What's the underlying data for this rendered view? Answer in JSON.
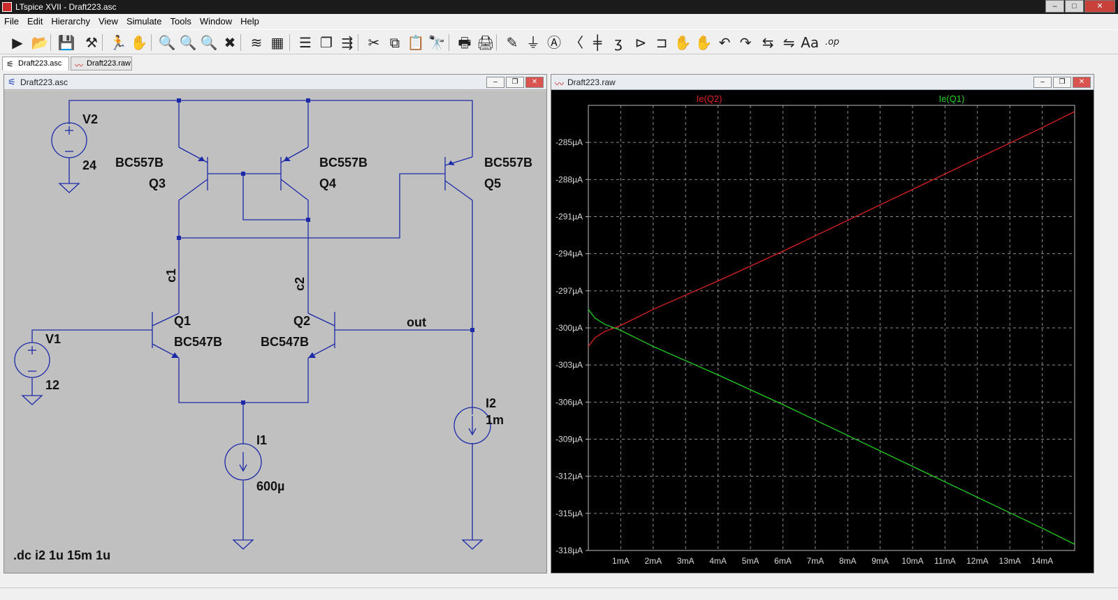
{
  "window": {
    "title": "LTspice XVII - Draft223.asc",
    "min": "–",
    "max": "□",
    "close": "✕"
  },
  "menu": [
    "File",
    "Edit",
    "Hierarchy",
    "View",
    "Simulate",
    "Tools",
    "Window",
    "Help"
  ],
  "toolbar": {
    "icons": [
      "run-icon",
      "open-icon",
      "save-icon",
      "control-panel-icon",
      "halt-icon",
      "hand-icon",
      "zoom-in-icon",
      "zoom-pan-icon",
      "zoom-out-icon",
      "zoom-fit-icon",
      "autorange-icon",
      "grid-icon",
      "tile-horizontal-icon",
      "cascade-icon",
      "tile-vertical-icon",
      "cut-icon",
      "copy-icon",
      "paste-icon",
      "find-icon",
      "print-icon",
      "print-setup-icon",
      "wire-icon",
      "ground-icon",
      "label-icon",
      "resistor-icon",
      "capacitor-icon",
      "inductor-icon",
      "diode-icon",
      "component-icon",
      "move-icon",
      "drag-icon",
      "undo-icon",
      "redo-icon",
      "rotate-icon",
      "mirror-icon",
      "text-icon",
      "spice-directive-icon"
    ],
    "glyphs": [
      "▶",
      "📂",
      "💾",
      "⚒",
      "🏃",
      "✋",
      "🔍",
      "🔍",
      "🔍",
      "✖",
      "≋",
      "▦",
      "☰",
      "❐",
      "⇶",
      "✂",
      "⧉",
      "📋",
      "🔭",
      "🖶",
      "🖨",
      "✎",
      "⏚",
      "Ⓐ",
      "〈",
      "╪",
      "ʒ",
      "⊳",
      "⊐",
      "✋",
      "✋",
      "↶",
      "↷",
      "⇆",
      "⇋",
      "Aa",
      ".op"
    ]
  },
  "tabs": [
    {
      "label": "Draft223.asc",
      "icon": "⚟"
    },
    {
      "label": "Draft223.raw",
      "icon": "〰"
    }
  ],
  "schematic_window": {
    "title": "Draft223.asc",
    "components": {
      "v2": {
        "name": "V2",
        "value": "24"
      },
      "v1": {
        "name": "V1",
        "value": "12"
      },
      "q3": {
        "model": "BC557B",
        "name": "Q3"
      },
      "q4": {
        "model": "BC557B",
        "name": "Q4"
      },
      "q5": {
        "model": "BC557B",
        "name": "Q5"
      },
      "q1": {
        "name": "Q1",
        "model": "BC547B"
      },
      "q2": {
        "name": "Q2",
        "model": "BC547B"
      },
      "i1": {
        "name": "I1",
        "value": "600µ"
      },
      "i2": {
        "name": "I2",
        "value": "1m"
      }
    },
    "net_labels": {
      "c1": "c1",
      "c2": "c2",
      "out": "out"
    },
    "directive": ".dc i2 1u 15m 1u"
  },
  "plot_window": {
    "title": "Draft223.raw"
  },
  "chart_data": {
    "type": "line",
    "xlim": [
      0,
      15
    ],
    "ylim": [
      -318,
      -282
    ],
    "x_ticks": [
      "1mA",
      "2mA",
      "3mA",
      "4mA",
      "5mA",
      "6mA",
      "7mA",
      "8mA",
      "9mA",
      "10mA",
      "11mA",
      "12mA",
      "13mA",
      "14mA"
    ],
    "x_tick_values": [
      1,
      2,
      3,
      4,
      5,
      6,
      7,
      8,
      9,
      10,
      11,
      12,
      13,
      14
    ],
    "y_ticks": [
      "-285µA",
      "-288µA",
      "-291µA",
      "-294µA",
      "-297µA",
      "-300µA",
      "-303µA",
      "-306µA",
      "-309µA",
      "-312µA",
      "-315µA",
      "-318µA"
    ],
    "y_tick_values": [
      -285,
      -288,
      -291,
      -294,
      -297,
      -300,
      -303,
      -306,
      -309,
      -312,
      -315,
      -318
    ],
    "grid": true,
    "series": [
      {
        "name": "Ie(Q2)",
        "color": "#e02020",
        "x": [
          0,
          0.2,
          0.5,
          1,
          2,
          4,
          6,
          8,
          10,
          12,
          14,
          15
        ],
        "y": [
          -301.5,
          -300.8,
          -300.3,
          -299.8,
          -298.5,
          -296.2,
          -293.8,
          -291.3,
          -288.8,
          -286.3,
          -283.8,
          -282.5
        ]
      },
      {
        "name": "Ie(Q1)",
        "color": "#20d020",
        "x": [
          0,
          0.2,
          0.5,
          1,
          2,
          4,
          6,
          8,
          10,
          12,
          14,
          15
        ],
        "y": [
          -298.5,
          -299.2,
          -299.7,
          -300.2,
          -301.5,
          -303.8,
          -306.2,
          -308.7,
          -311.2,
          -313.7,
          -316.2,
          -317.5
        ]
      }
    ]
  }
}
